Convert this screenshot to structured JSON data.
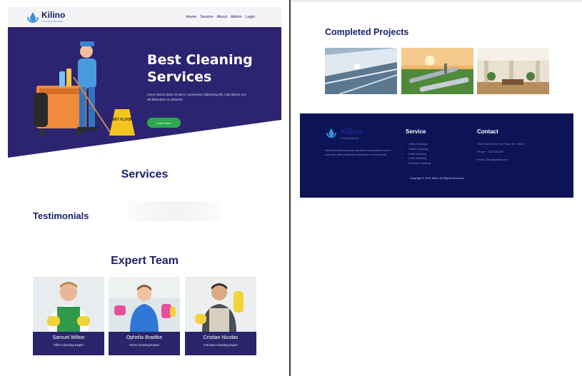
{
  "brand": {
    "name": "Kilino",
    "tagline": "Cleaning Services"
  },
  "nav": {
    "items": [
      "Home",
      "Service",
      "About",
      "Admin",
      "Login"
    ]
  },
  "hero": {
    "title": "Best Cleaning Services",
    "description": "Lorem ipsum dolor sit amet, consectetur adipiscing elit. Iulia dictum orci elit bibendum ac pharetra.",
    "button_label": "Learn More",
    "sign_text": "WET FLOOR"
  },
  "sections": {
    "services": "Services",
    "testimonials": "Testimonials",
    "team": "Expert Team",
    "projects": "Completed Projects"
  },
  "team": [
    {
      "name": "Samuel Wilton",
      "role": "Office Cleaning Expert"
    },
    {
      "name": "Ophelia Bradtke",
      "role": "Home Cleaning Expert"
    },
    {
      "name": "Cristian Nicolas",
      "role": "Furniture Cleaning Expert"
    }
  ],
  "footer": {
    "about": "Excepteur sint occaecat cupidatat non proident, sunt in culpa qui officia deserunt mollit anim id est laborum.",
    "service_heading": "Service",
    "services": [
      "Office Cleaning",
      "House Cleaning",
      "Hotel Cleaning",
      "Cloth Cleaning",
      "Furniture Cleaning"
    ],
    "contact_heading": "Contact",
    "address": "2289 Oak Street, Old Forge, NY 13420",
    "phone": "Phone : +125 408 887",
    "email": "Email: Clean@gmail.com",
    "copyright": "Copyright © 2021 Kilino All Rights Reserved"
  },
  "colors": {
    "hero_bg": "#2c2470",
    "footer_bg": "#0c1356",
    "heading": "#1a1f6a",
    "button": "#2fa84f",
    "team_bar": "#2a246b"
  }
}
